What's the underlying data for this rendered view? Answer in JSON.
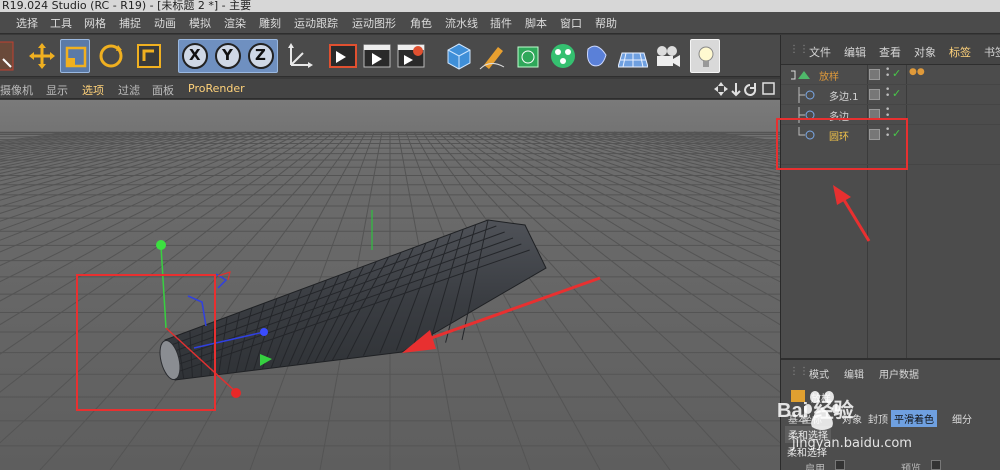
{
  "window": {
    "title": "R19.024 Studio (RC - R19) - [未标题 2 *] - 主要"
  },
  "menu": {
    "items": [
      "选择",
      "工具",
      "网格",
      "捕捉",
      "动画",
      "模拟",
      "渲染",
      "雕刻",
      "运动跟踪",
      "运动图形",
      "角色",
      "流水线",
      "插件",
      "脚本",
      "窗口",
      "帮助"
    ]
  },
  "toolbar": {
    "buttons": [
      "cursor-icon",
      "move-icon",
      "scale-icon",
      "rotate-icon",
      "recent-tool-icon",
      "x-axis-lock-icon",
      "y-axis-lock-icon",
      "z-axis-lock-icon",
      "coordinate-system-icon",
      "render-view-icon",
      "render-picture-viewer-icon",
      "render-settings-icon",
      "cube-icon",
      "pen-icon",
      "subdivision-icon",
      "cloner-icon",
      "deformer-icon",
      "floor-icon",
      "camera-icon",
      "light-icon"
    ],
    "axis_labels": {
      "x": "X",
      "y": "Y",
      "z": "Z"
    }
  },
  "viewport": {
    "menu": [
      "摄像机",
      "显示",
      "选项",
      "过滤",
      "面板",
      "ProRender"
    ]
  },
  "object_manager": {
    "tabs": [
      "文件",
      "编辑",
      "查看",
      "对象",
      "标签",
      "书签"
    ],
    "objects": [
      {
        "name": "放样",
        "level": 0,
        "color": "#e09a3a"
      },
      {
        "name": "多边.1",
        "level": 1,
        "color": "#d6d6d6"
      },
      {
        "name": "多边",
        "level": 1,
        "color": "#d6d6d6"
      },
      {
        "name": "圆环",
        "level": 1,
        "color": "#f0c24a"
      }
    ]
  },
  "attributes": {
    "menu": [
      "模式",
      "编辑",
      "用户数据"
    ],
    "object_label": "放样",
    "tabs": [
      "基本",
      "坐标",
      "对象",
      "封顶",
      "平滑着色",
      "细分",
      "柔和选择"
    ],
    "section_title": "柔和选择",
    "field_label": "启用",
    "field2_label": "预览"
  },
  "watermark": {
    "logo_text": "Bai 经验",
    "url": "jingyan.baidu.com"
  },
  "colors": {
    "accent_yellow": "#f0c24a",
    "highlight_red": "#e83030",
    "check_green": "#48c848"
  }
}
